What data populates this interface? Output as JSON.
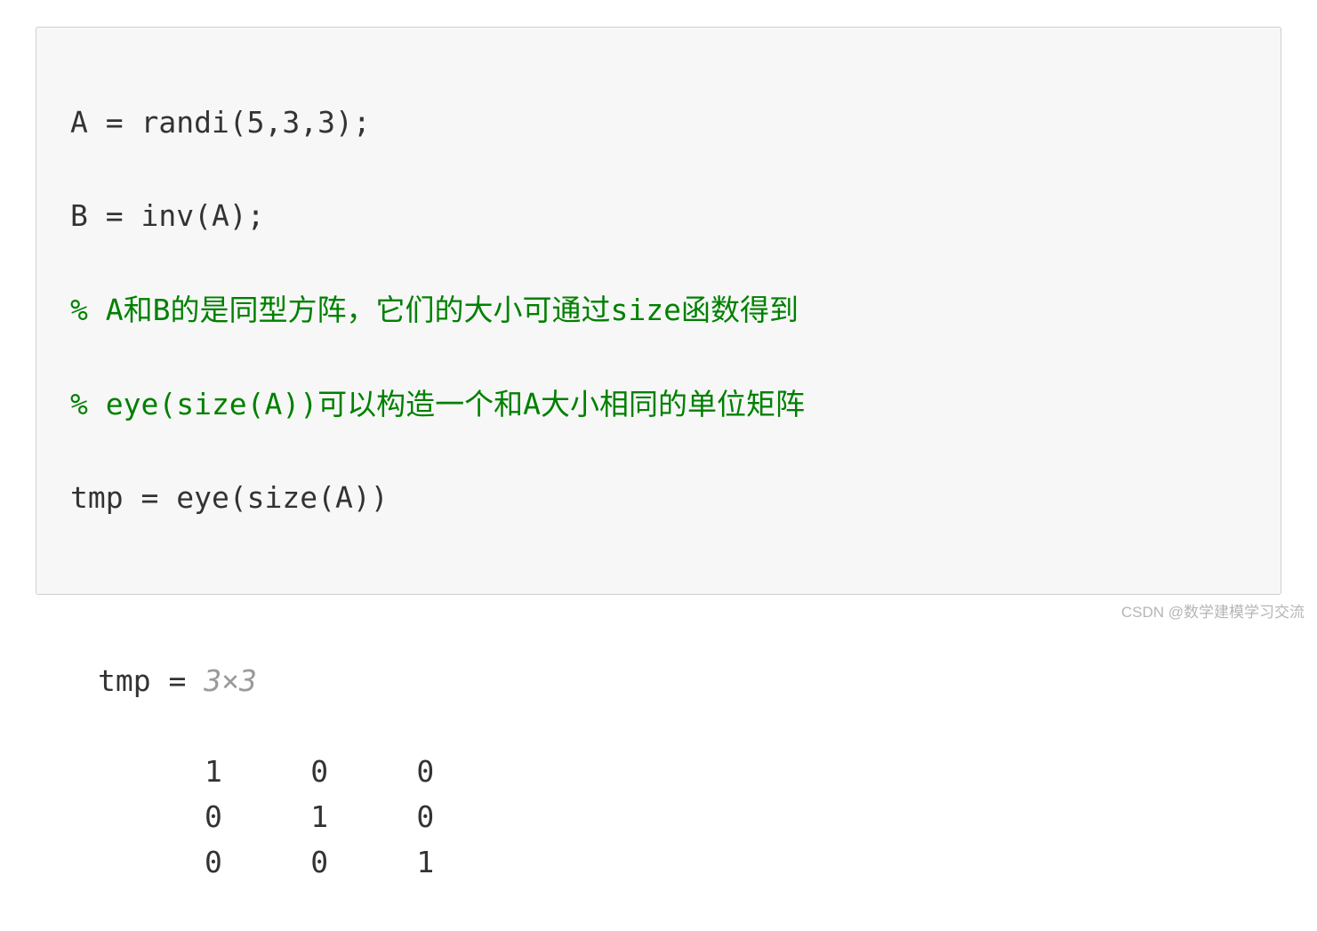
{
  "code": {
    "line1": "A = randi(5,3,3);",
    "line2": "B = inv(A);",
    "line3": "% A和B的是同型方阵，它们的大小可通过size函数得到",
    "line4": "% eye(size(A))可以构造一个和A大小相同的单位矩阵",
    "line5": "tmp = eye(size(A))"
  },
  "output": {
    "var_prefix": "tmp = ",
    "dim": "3×3",
    "matrix": {
      "r1": "1     0     0",
      "r2": "0     1     0",
      "r3": "0     0     1"
    }
  },
  "watermark": "CSDN @数学建模学习交流"
}
